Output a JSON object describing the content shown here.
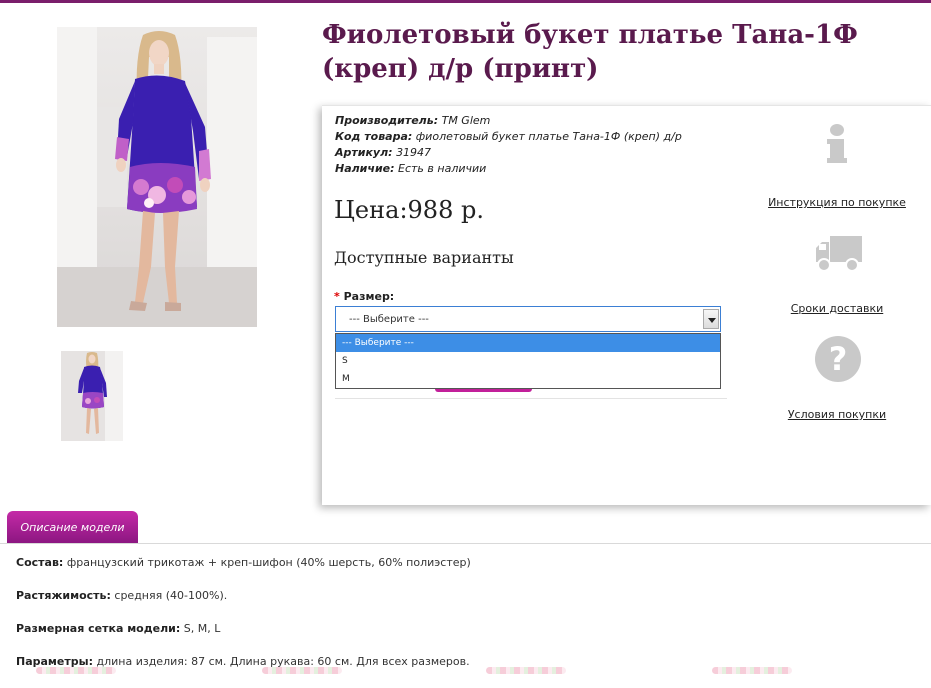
{
  "product": {
    "title": "Фиолетовый букет платье Тана-1Ф (креп) д/р (принт)",
    "meta": [
      {
        "key": "Производитель:",
        "value": "ТМ Glem"
      },
      {
        "key": "Код товара:",
        "value": "фиолетовый букет платье Тана-1Ф (креп) д/р"
      },
      {
        "key": "Артикул:",
        "value": "31947"
      },
      {
        "key": "Наличие:",
        "value": "Есть в наличии"
      }
    ],
    "price": "Цена:988 р.",
    "variants_title": "Доступные варианты",
    "size_label": "Размер:",
    "size_required_mark": "*",
    "size_select": {
      "value": "--- Выберите ---",
      "options": [
        "--- Выберите ---",
        "S",
        "M"
      ]
    }
  },
  "sidebar_links": {
    "instructions": "Инструкция по покупке",
    "delivery": "Сроки доставки",
    "conditions": "Условия покупки"
  },
  "icons": {
    "info": "info-icon",
    "truck": "truck-icon",
    "question": "question-mark-icon"
  },
  "tab": {
    "label": "Описание модели"
  },
  "description": [
    {
      "key": "Состав:",
      "value": "французский трикотаж + креп-шифон (40% шерсть, 60% полиэстер)"
    },
    {
      "key": "Растяжимость:",
      "value": "средняя (40-100%)."
    },
    {
      "key": "Размерная сетка модели:",
      "value": "S, M, L"
    },
    {
      "key": "Параметры:",
      "value": "длина изделия: 87 см. Длина рукава: 60 см. Для всех размеров."
    }
  ],
  "colors": {
    "accent": "#7a1e6b",
    "title": "#5a1a4d",
    "tab": "#b0229a",
    "select_highlight": "#3d8ee6",
    "dress": "#3a1fb0"
  }
}
